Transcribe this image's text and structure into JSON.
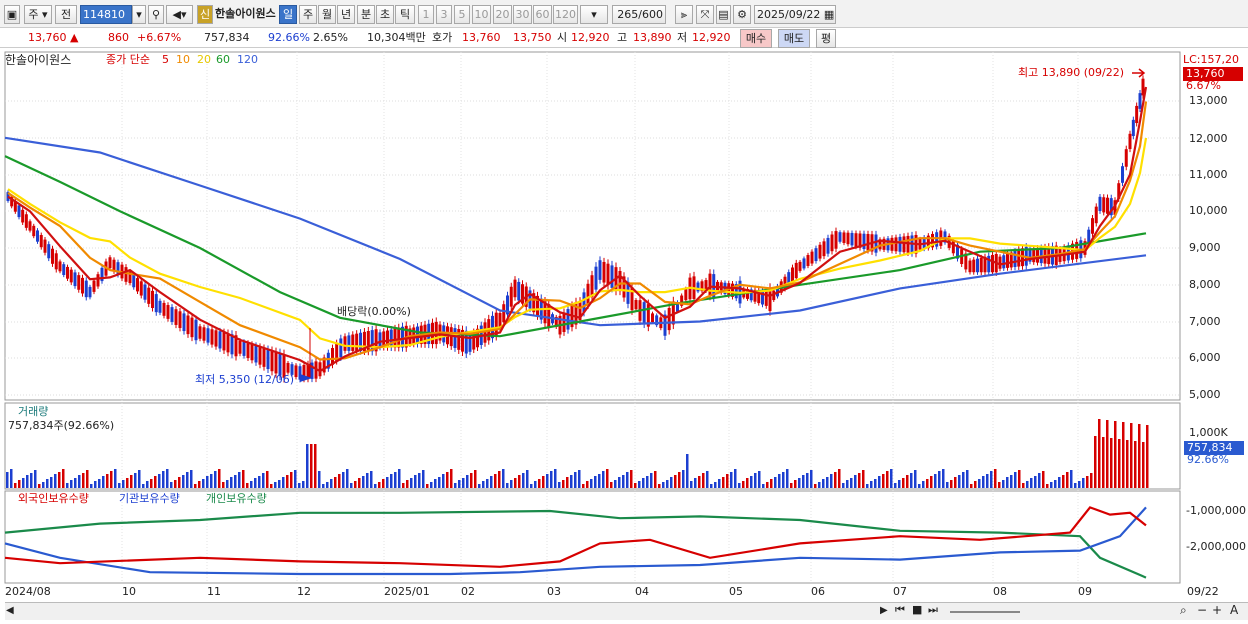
{
  "toolbar": {
    "market": "주",
    "type_label": "전",
    "code": "114810",
    "stock_name": "한솔아이원스",
    "new_badge": "신",
    "periods": [
      "일",
      "주",
      "월",
      "년",
      "분",
      "초",
      "틱"
    ],
    "intervals": [
      "1",
      "3",
      "5",
      "10",
      "20",
      "30",
      "60",
      "120"
    ],
    "count": "265",
    "count_total": "/600",
    "date": "2025/09/22"
  },
  "quote": {
    "price": "13,760",
    "change": "860",
    "change_pct": "+6.67%",
    "volume": "757,834",
    "volume_pct": "92.66%",
    "turnover_pct": "2.65%",
    "amount": "10,304백만",
    "hoga_label": "호가",
    "ask": "13,760",
    "bid": "13,750",
    "open_label": "시",
    "open": "12,920",
    "high_label": "고",
    "high": "13,890",
    "low_label": "저",
    "low": "12,920",
    "buy": "매수",
    "sell": "매도",
    "avg": "평"
  },
  "price_panel": {
    "stock_name": "한솔아이원스",
    "ma_label": "종가 단순",
    "ma_periods": [
      "5",
      "10",
      "20",
      "60",
      "120"
    ],
    "lc_label": "LC:157,20",
    "current": "13,760",
    "current_pct": "6.67%",
    "high_note": "최고 13,890 (09/22)",
    "low_note": "최저 5,350 (12/06)",
    "dividend_note": "배당락(0.00%)",
    "yticks": [
      "13,000",
      "12,000",
      "11,000",
      "10,000",
      "9,000",
      "8,000",
      "7,000",
      "6,000",
      "5,000"
    ]
  },
  "volume_panel": {
    "title": "거래량",
    "value_note": "757,834주(92.66%)",
    "ytick": "1,000K",
    "current": "757,834",
    "current_pct": "92.66%"
  },
  "holders_panel": {
    "legend": [
      "외국인보유수량",
      "기관보유수량",
      "개인보유수량"
    ],
    "yticks": [
      "-1,000,000",
      "-2,000,000"
    ]
  },
  "xaxis": [
    "2024/08",
    "10",
    "11",
    "12",
    "2025/01",
    "02",
    "03",
    "04",
    "05",
    "06",
    "07",
    "08",
    "09",
    "09/22"
  ],
  "chart_data": {
    "type": "line",
    "title": "한솔아이원스",
    "price_range": [
      5000,
      14000
    ],
    "series": [
      {
        "name": "5",
        "color": "#d01010"
      },
      {
        "name": "10",
        "color": "#f08a00"
      },
      {
        "name": "20",
        "color": "#ffe000"
      },
      {
        "name": "60",
        "color": "#1a9a2a"
      },
      {
        "name": "120",
        "color": "#3a5fd8"
      }
    ],
    "high": 13890,
    "low": 5350,
    "last": 13760
  }
}
